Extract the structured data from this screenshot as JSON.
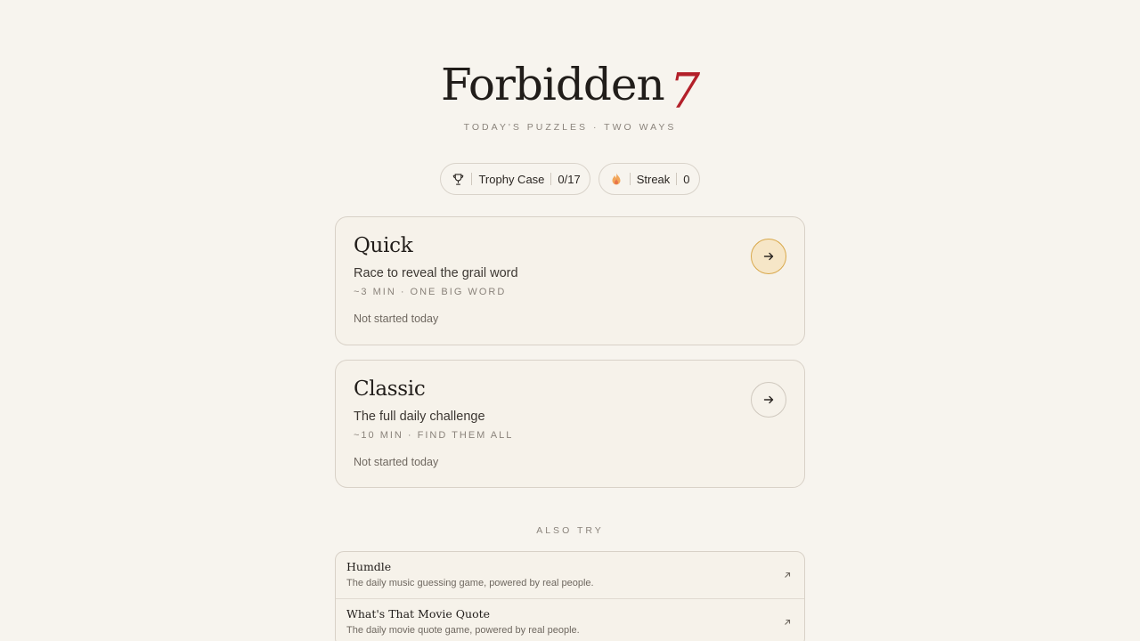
{
  "header": {
    "title": "Forbidden",
    "title_number": "7",
    "subtitle": "TODAY'S PUZZLES · TWO WAYS"
  },
  "pills": {
    "trophy": {
      "icon": "trophy-icon",
      "label": "Trophy Case",
      "value": "0/17"
    },
    "streak": {
      "icon": "flame-icon",
      "label": "Streak",
      "value": "0"
    }
  },
  "modes": [
    {
      "title": "Quick",
      "description": "Race to reveal the grail word",
      "meta": "~3 MIN · ONE BIG WORD",
      "status": "Not started today",
      "icon": "arrow-right-icon"
    },
    {
      "title": "Classic",
      "description": "The full daily challenge",
      "meta": "~10 MIN · FIND THEM ALL",
      "status": "Not started today",
      "icon": "arrow-right-icon"
    }
  ],
  "also_try": {
    "heading": "ALSO TRY",
    "items": [
      {
        "title": "Humdle",
        "description": "The daily music guessing game, powered by real people.",
        "icon": "external-link-icon"
      },
      {
        "title": "What's That Movie Quote",
        "description": "The daily movie quote game, powered by real people.",
        "icon": "external-link-icon"
      }
    ]
  },
  "colors": {
    "background": "#f7f4ee",
    "accent_red": "#b3202a",
    "active_button": "#f6e6c7",
    "active_border": "#d9a84a"
  }
}
